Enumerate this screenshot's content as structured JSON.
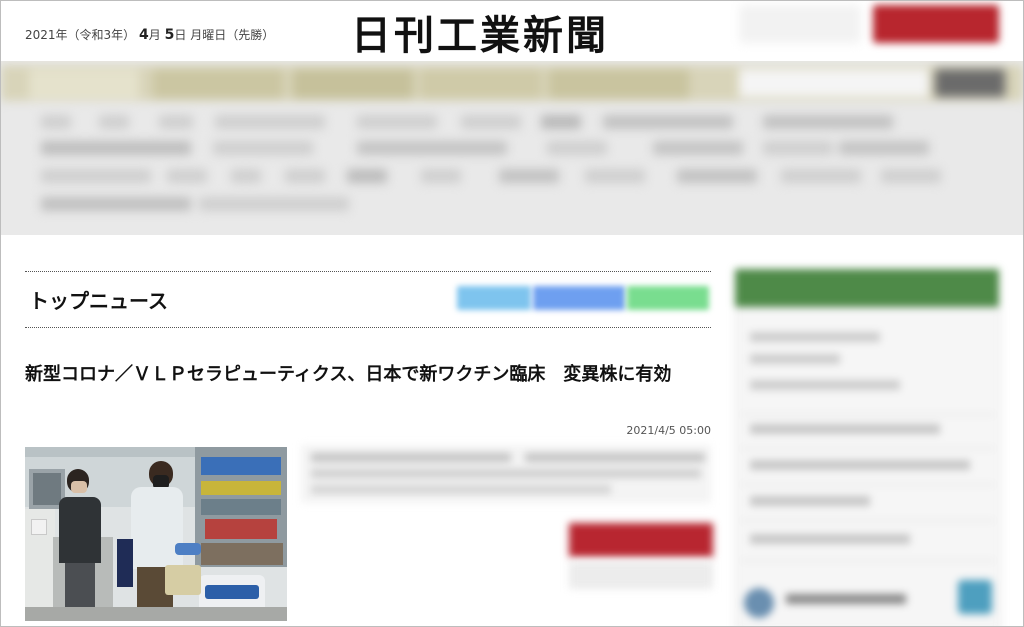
{
  "header": {
    "date_year": "2021年（令和3年）",
    "date_month_num": "4",
    "date_month_unit": "月",
    "date_day_num": "5",
    "date_day_unit": "日",
    "date_weekday": "月曜日（先勝）",
    "logo_text": "日刊工業新聞"
  },
  "main": {
    "section_title": "トップニュース",
    "article": {
      "headline": "新型コロナ／ＶＬＰセラピューティクス、日本で新ワクチン臨床　変異株に有効",
      "timestamp": "2021/4/5 05:00"
    }
  },
  "colors": {
    "brand_red": "#b8262e",
    "nav_bar": "#d8d4b9",
    "sidebar_green": "#4e8a48"
  }
}
